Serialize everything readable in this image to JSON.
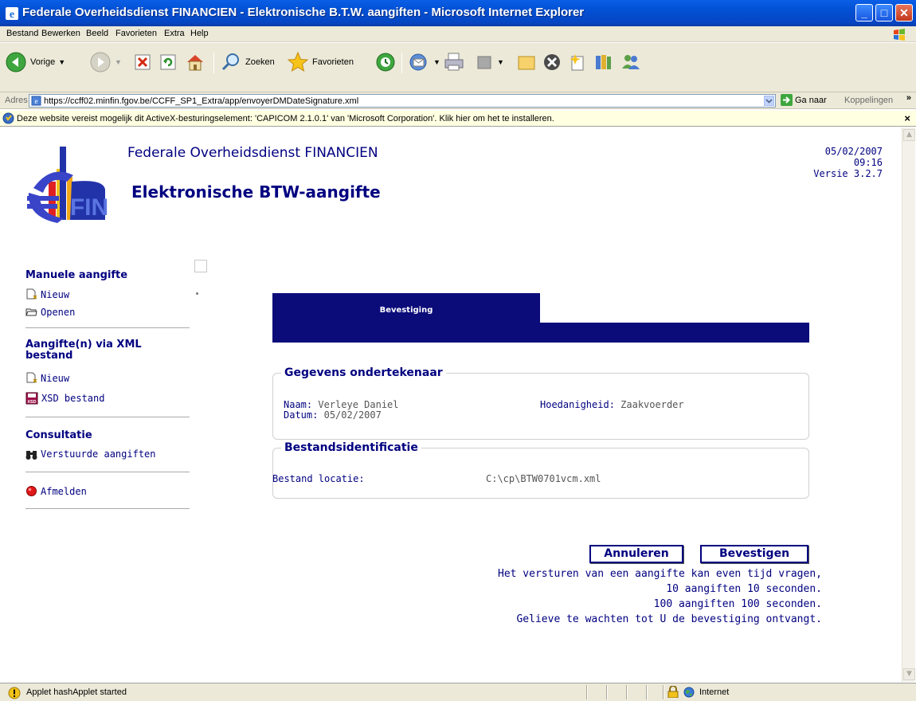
{
  "window": {
    "title": "Federale Overheidsdienst FINANCIEN - Elektronische B.T.W. aangiften - Microsoft Internet Explorer",
    "minimize": "_",
    "maximize": "□",
    "close": "✕"
  },
  "menu": [
    "Bestand",
    "Bewerken",
    "Beeld",
    "Favorieten",
    "Extra",
    "Help"
  ],
  "toolbar": {
    "back": "Vorige",
    "search": "Zoeken",
    "favorites": "Favorieten"
  },
  "address": {
    "label": "Adres",
    "url": "https://ccff02.minfin.fgov.be/CCFF_SP1_Extra/app/envoyerDMDateSignature.xml",
    "go": "Ga naar",
    "links": "Koppelingen",
    "links_chevron": "»"
  },
  "infobar": {
    "text": "Deze website vereist mogelijk dit ActiveX-besturingselement: 'CAPICOM 2.1.0.1' van 'Microsoft Corporation'. Klik hier om het te installeren.",
    "close": "×"
  },
  "header": {
    "org": "Federale Overheidsdienst FINANCIEN",
    "app": "Elektronische BTW-aangifte",
    "date": "05/02/2007",
    "time": "09:16",
    "version": "Versie 3.2.7",
    "logo_text": "FIN"
  },
  "sidebar": {
    "manual_title": "Manuele aangifte",
    "manual_new": "Nieuw",
    "manual_open": "Openen",
    "xml_title": "Aangifte(n) via XML bestand",
    "xml_new": "Nieuw",
    "xml_xsd": "XSD bestand",
    "consult_title": "Consultatie",
    "consult_sent": "Verstuurde aangiften",
    "logout": "Afmelden"
  },
  "main": {
    "tab": "Bevestiging",
    "signer": {
      "legend": "Gegevens ondertekenaar",
      "name_label": "Naam:",
      "name": "Verleye Daniel",
      "date_label": "Datum:",
      "date": "05/02/2007",
      "role_label": "Hoedanigheid:",
      "role": "Zaakvoerder"
    },
    "file": {
      "legend": "Bestandsidentificatie",
      "location_label": "Bestand locatie:",
      "location": "C:\\cp\\BTW0701vcm.xml"
    },
    "cancel_button": "Annuleren",
    "confirm_button": "Bevestigen",
    "note": [
      "Het versturen van een aangifte kan even tijd vragen,",
      "10 aangiften 10 seconden.",
      "100 aangiften 100 seconden.",
      "Gelieve te wachten tot U de bevestiging ontvangt."
    ]
  },
  "status": {
    "text": "Applet hashApplet started",
    "zone": "Internet"
  }
}
